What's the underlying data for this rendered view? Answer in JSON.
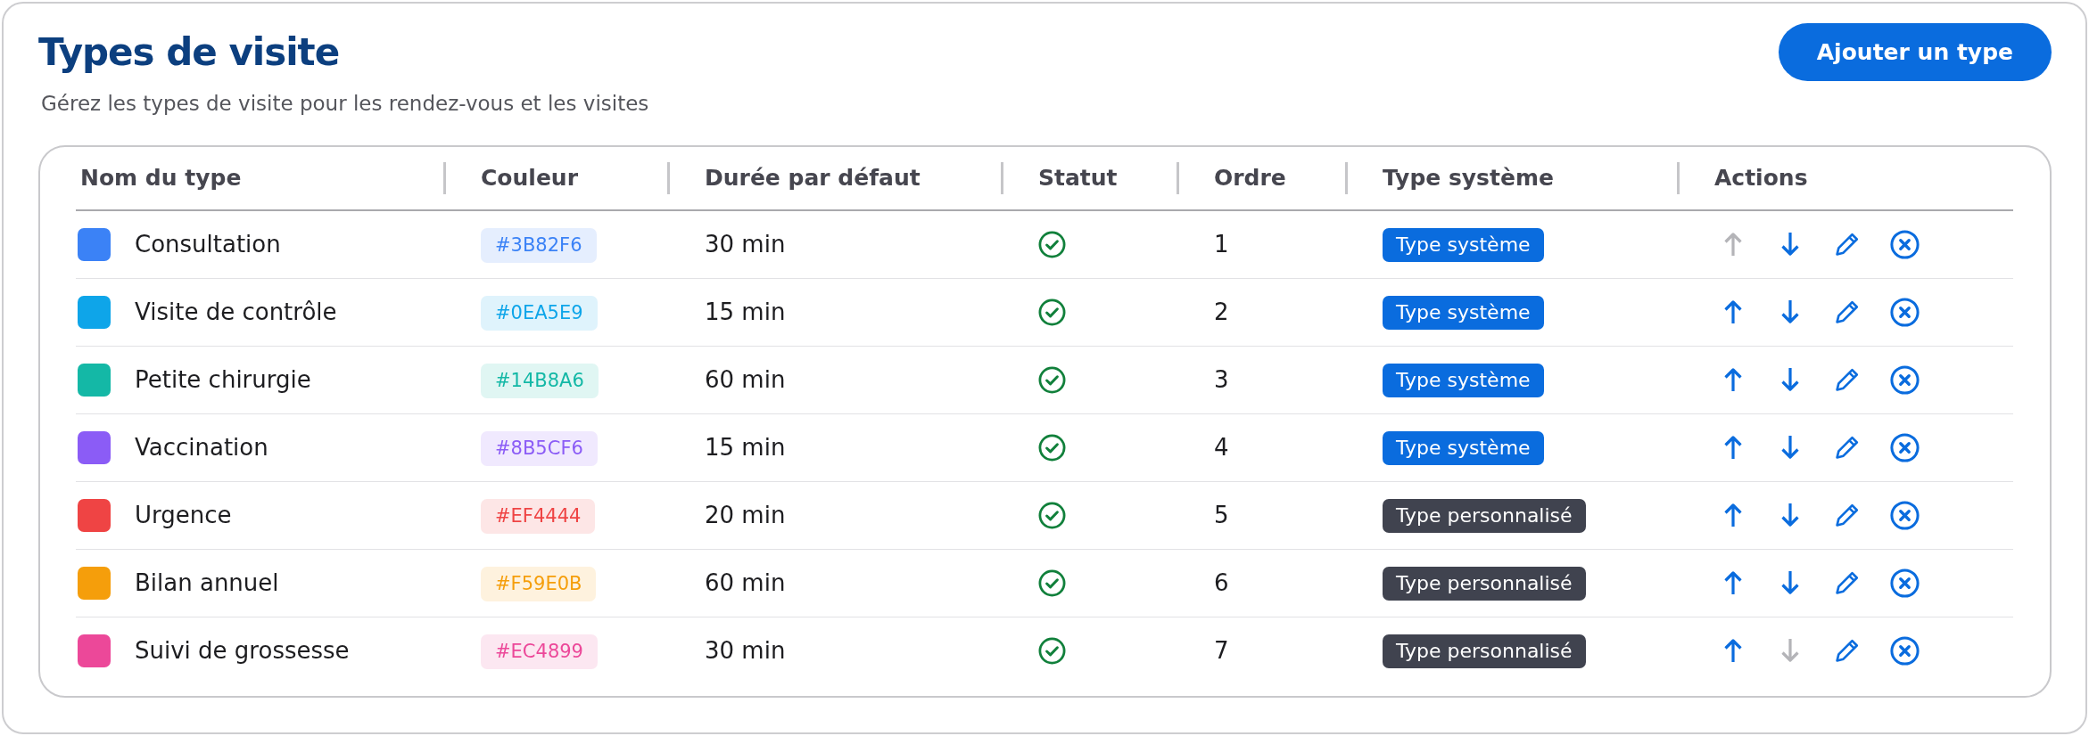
{
  "page": {
    "title": "Types de visite",
    "subtitle": "Gérez les types de visite pour les rendez-vous et les visites",
    "add_button": "Ajouter un type"
  },
  "table": {
    "columns": [
      "Nom du type",
      "Couleur",
      "Durée par défaut",
      "Statut",
      "Ordre",
      "Type système",
      "Actions"
    ],
    "rows": [
      {
        "name": "Consultation",
        "color": "#3b82f6",
        "color_code": "#3B82F6",
        "duration": "30 min",
        "active": true,
        "order": "1",
        "system": true,
        "type_label": "Type système",
        "up_disabled": true,
        "down_disabled": false
      },
      {
        "name": "Visite de contrôle",
        "color": "#0ea5e9",
        "color_code": "#0EA5E9",
        "duration": "15 min",
        "active": true,
        "order": "2",
        "system": true,
        "type_label": "Type système",
        "up_disabled": false,
        "down_disabled": false
      },
      {
        "name": "Petite chirurgie",
        "color": "#14b8a6",
        "color_code": "#14B8A6",
        "duration": "60 min",
        "active": true,
        "order": "3",
        "system": true,
        "type_label": "Type système",
        "up_disabled": false,
        "down_disabled": false
      },
      {
        "name": "Vaccination",
        "color": "#8b5cf6",
        "color_code": "#8B5CF6",
        "duration": "15 min",
        "active": true,
        "order": "4",
        "system": true,
        "type_label": "Type système",
        "up_disabled": false,
        "down_disabled": false
      },
      {
        "name": "Urgence",
        "color": "#ef4444",
        "color_code": "#EF4444",
        "duration": "20 min",
        "active": true,
        "order": "5",
        "system": false,
        "type_label": "Type personnalisé",
        "up_disabled": false,
        "down_disabled": false
      },
      {
        "name": "Bilan annuel",
        "color": "#f59e0b",
        "color_code": "#F59E0B",
        "duration": "60 min",
        "active": true,
        "order": "6",
        "system": false,
        "type_label": "Type personnalisé",
        "up_disabled": false,
        "down_disabled": false
      },
      {
        "name": "Suivi de grossesse",
        "color": "#ec4899",
        "color_code": "#EC4899",
        "duration": "30 min",
        "active": true,
        "order": "7",
        "system": false,
        "type_label": "Type personnalisé",
        "up_disabled": false,
        "down_disabled": true
      }
    ]
  }
}
